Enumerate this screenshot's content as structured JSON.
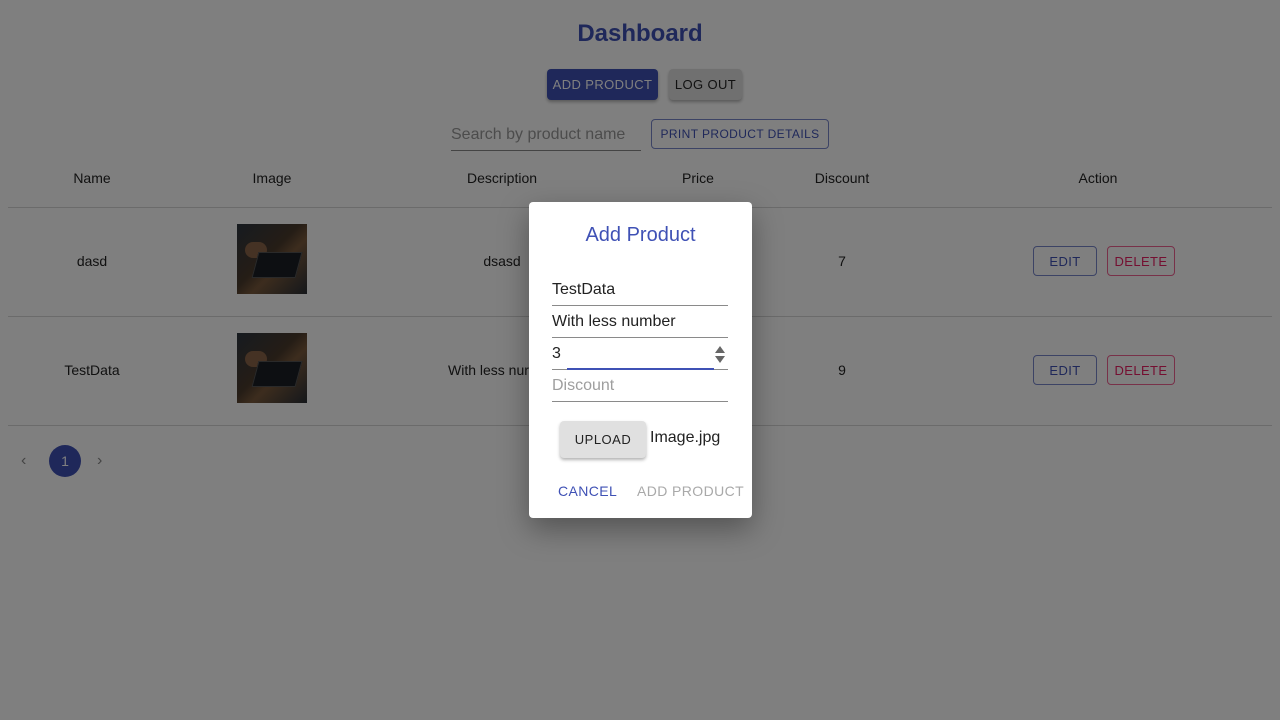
{
  "header": {
    "title": "Dashboard",
    "add_product_label": "ADD PRODUCT",
    "logout_label": "LOG OUT"
  },
  "search": {
    "placeholder": "Search by product name",
    "print_label": "PRINT PRODUCT DETAILS"
  },
  "table": {
    "columns": [
      "Name",
      "Image",
      "Description",
      "Price",
      "Discount",
      "Action"
    ],
    "rows": [
      {
        "name": "dasd",
        "description": "dsasd",
        "discount": "7"
      },
      {
        "name": "TestData",
        "description": "With less nur",
        "discount": "9"
      }
    ],
    "edit_label": "EDIT",
    "delete_label": "DELETE"
  },
  "pagination": {
    "current_page": "1"
  },
  "dialog": {
    "title": "Add Product",
    "name_value": "TestData",
    "description_value": "With less number",
    "price_value": "3",
    "discount_placeholder": "Discount",
    "upload_label": "UPLOAD",
    "file_name": "Image.jpg",
    "cancel_label": "CANCEL",
    "submit_label": "ADD PRODUCT"
  },
  "colors": {
    "primary": "#3f51b5",
    "danger": "#e91e63",
    "overlay": "rgba(0,0,0,0.5)"
  }
}
